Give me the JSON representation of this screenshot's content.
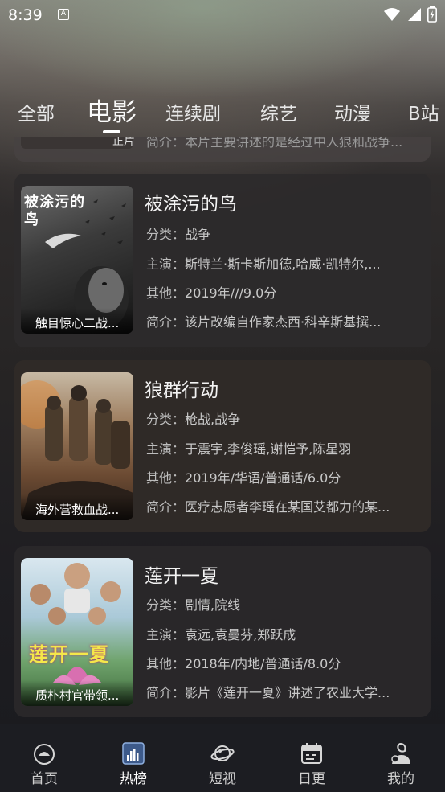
{
  "status_bar": {
    "time": "8:39",
    "notif_icon": "A"
  },
  "tabs": [
    {
      "label": "全部"
    },
    {
      "label": "电影"
    },
    {
      "label": "连续剧"
    },
    {
      "label": "综艺"
    },
    {
      "label": "动漫"
    },
    {
      "label": "B站"
    }
  ],
  "active_tab": "电影",
  "peek_card": {
    "badge": "正片",
    "text": "简介：本片主要讲述的是经过中人狼和战争..."
  },
  "movies": [
    {
      "title": "被涂污的鸟",
      "category_label": "分类：",
      "category": "战争",
      "cast_label": "主演：",
      "cast": "斯特兰·斯卡斯加德,哈威·凯特尔,...",
      "other_label": "其他：",
      "other": "2019年///9.0分",
      "summary_label": "简介：",
      "summary": "该片改编自作家杰西·科辛斯基撰...",
      "poster_caption": "触目惊心二战...",
      "poster_text": "被涂污的鸟"
    },
    {
      "title": "狼群行动",
      "category_label": "分类：",
      "category": "枪战,战争",
      "cast_label": "主演：",
      "cast": "于震宇,李俊瑶,谢恺予,陈星羽",
      "other_label": "其他：",
      "other": "2019年/华语/普通话/6.0分",
      "summary_label": "简介：",
      "summary": "医疗志愿者李瑶在某国艾都力的某...",
      "poster_caption": "海外营救血战..."
    },
    {
      "title": "莲开一夏",
      "category_label": "分类：",
      "category": "剧情,院线",
      "cast_label": "主演：",
      "cast": "袁远,袁曼芬,郑跃成",
      "other_label": "其他：",
      "other": "2018年/内地/普通话/8.0分",
      "summary_label": "简介：",
      "summary": "影片《莲开一夏》讲述了农业大学...",
      "poster_caption": "质朴村官带领...",
      "poster_text": "莲开一夏"
    }
  ],
  "bottom_nav": [
    {
      "label": "首页",
      "icon": "home-icon"
    },
    {
      "label": "热榜",
      "icon": "chart-icon"
    },
    {
      "label": "短视",
      "icon": "planet-icon"
    },
    {
      "label": "日更",
      "icon": "calendar-icon"
    },
    {
      "label": "我的",
      "icon": "user-icon"
    }
  ],
  "active_nav": "热榜"
}
